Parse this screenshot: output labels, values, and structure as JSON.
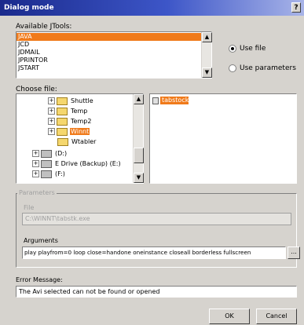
{
  "window": {
    "title": "Dialog mode",
    "help": "?"
  },
  "tools": {
    "label": "Available JTools:",
    "items": [
      "JAVA",
      "JCD",
      "JDMAIL",
      "JPRINTOR",
      "JSTART"
    ],
    "selected_index": 0
  },
  "mode": {
    "use_file": "Use file",
    "use_parameters": "Use parameters",
    "selected": "use_file"
  },
  "choose": {
    "label": "Choose file:",
    "tree": [
      {
        "label": "Shuttle",
        "type": "folder",
        "expander": "+"
      },
      {
        "label": "Temp",
        "type": "folder",
        "expander": "+"
      },
      {
        "label": "Temp2",
        "type": "folder",
        "expander": "+"
      },
      {
        "label": "Winnt",
        "type": "folder",
        "expander": "+",
        "selected": true
      },
      {
        "label": "Wtabler",
        "type": "folder",
        "expander": ""
      },
      {
        "label": "(D:)",
        "type": "drive",
        "expander": "+"
      },
      {
        "label": "E Drive (Backup) (E:)",
        "type": "drive",
        "expander": "+"
      },
      {
        "label": "(F:)",
        "type": "drive",
        "expander": "+"
      }
    ],
    "file_selected": "tabstock"
  },
  "params": {
    "group_label": "Parameters",
    "file_label": "File",
    "file_value": "C:\\WINNT\\tabstk.exe",
    "arguments_label": "Arguments",
    "arguments_value": "play playfrom=0 loop close=handone oneinstance closeall borderless fullscreen",
    "browse_label": "..."
  },
  "error": {
    "label": "Error Message:",
    "value": "The Avi selected can not be found or opened"
  },
  "buttons": {
    "ok": "OK",
    "cancel": "Cancel"
  },
  "colors": {
    "selection": "#f07a1a",
    "titlebar_start": "#1a2a8c"
  }
}
